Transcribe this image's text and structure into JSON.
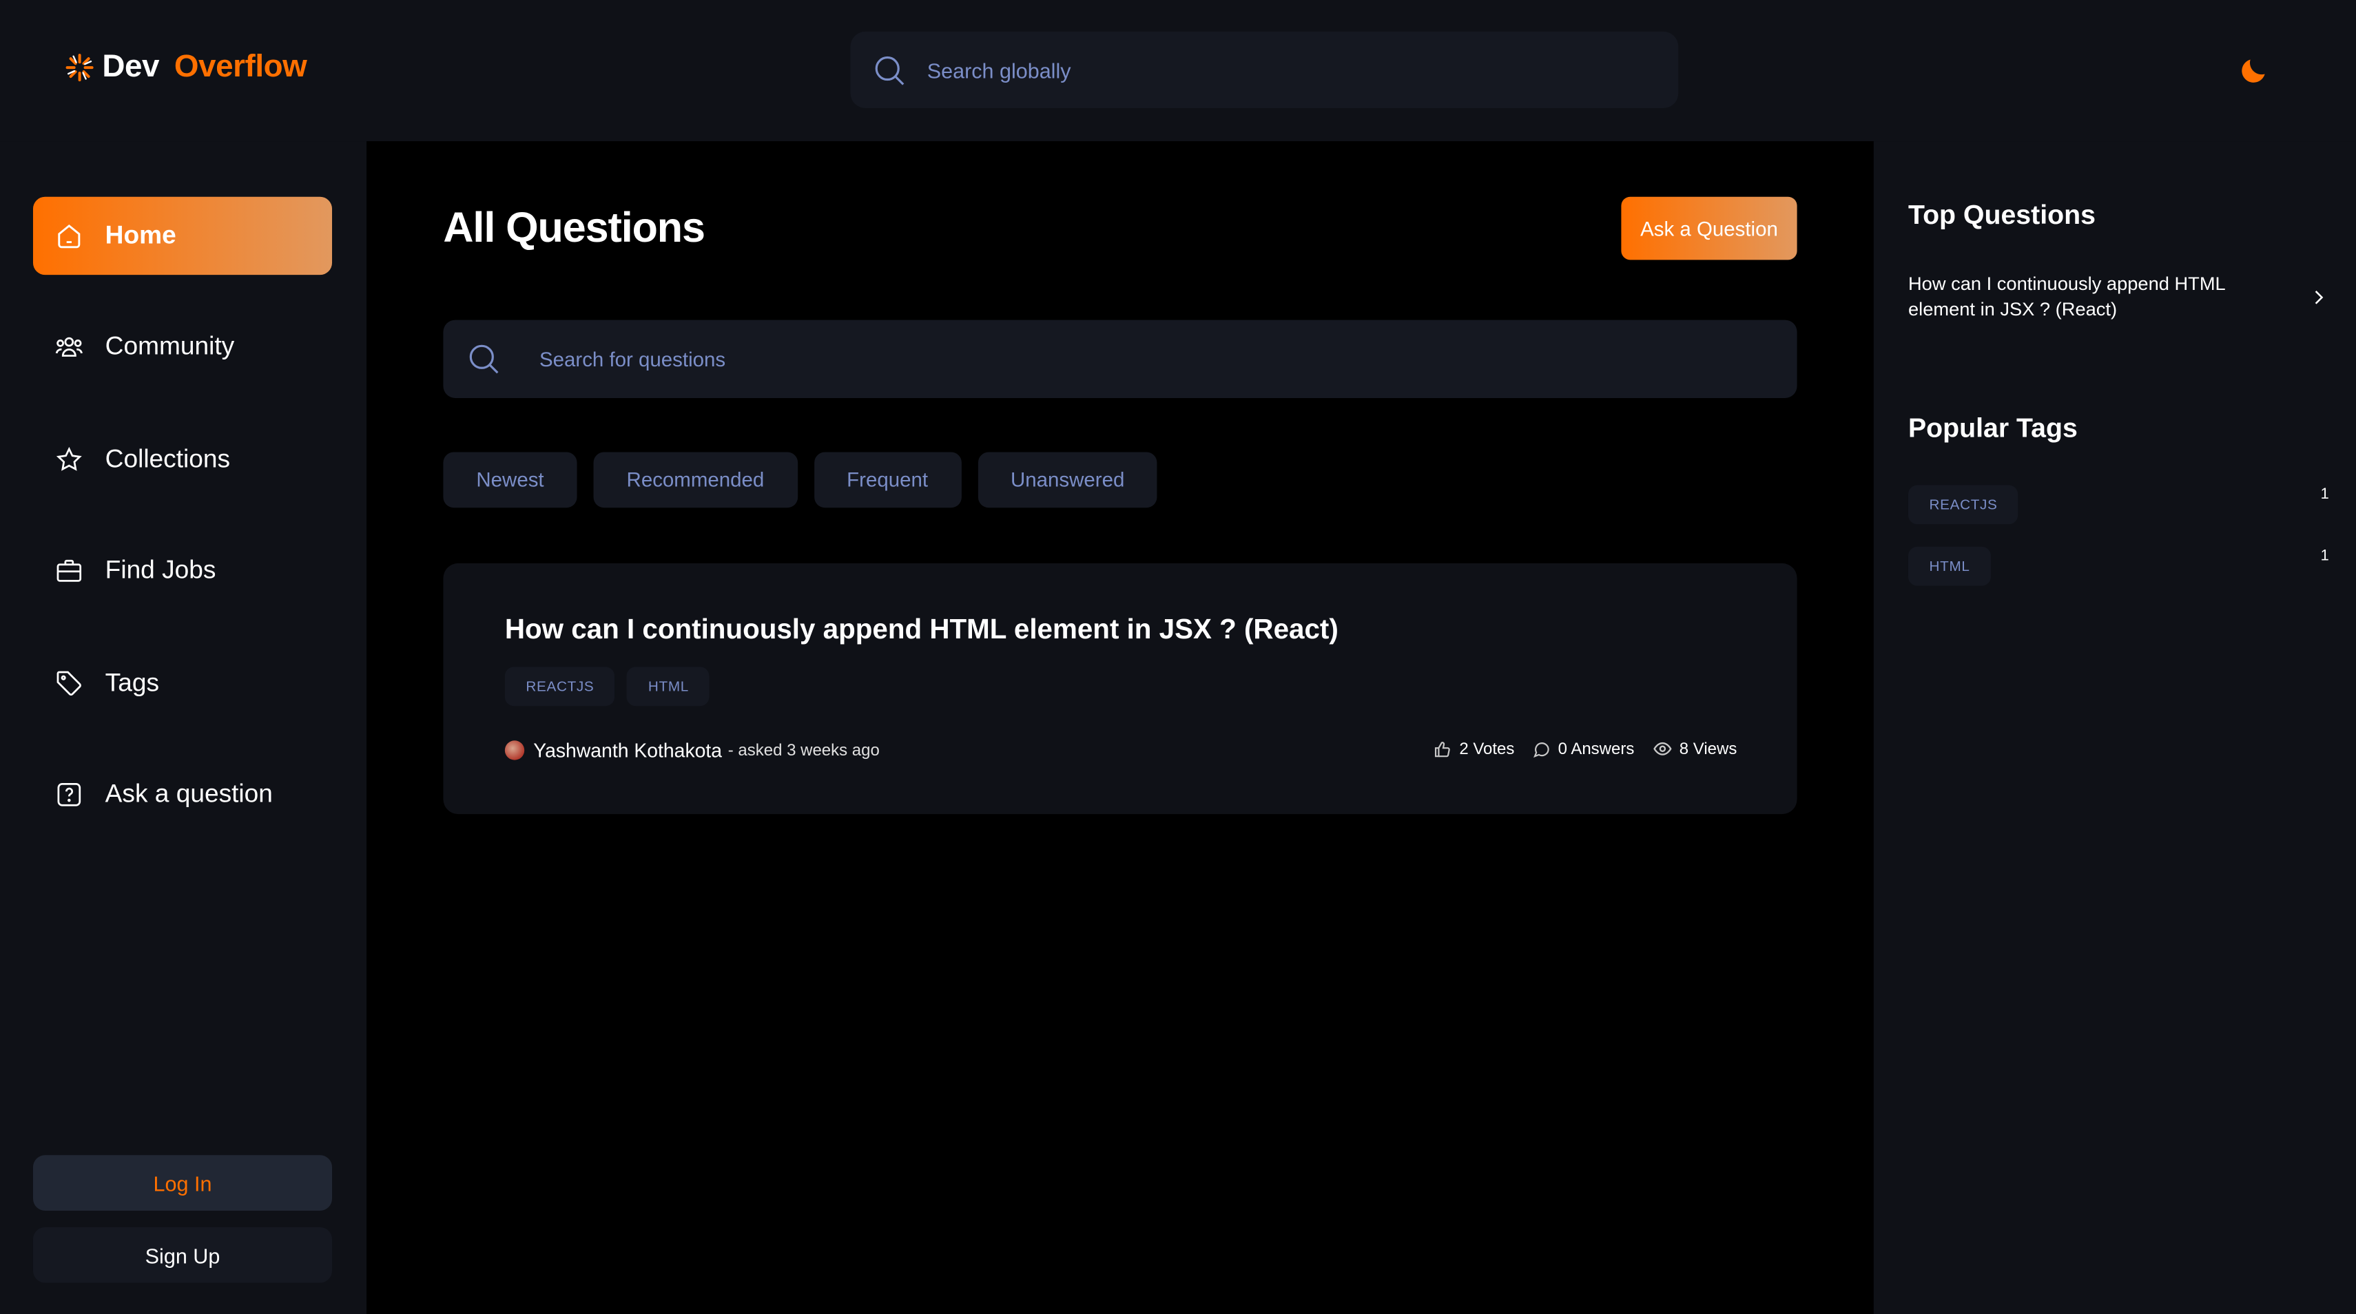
{
  "brand": {
    "dev": "Dev",
    "overflow": "Overflow"
  },
  "colors": {
    "accent": "#ff7000",
    "accent_end": "#e2985e",
    "bg": "#000000",
    "panel": "#0f1117",
    "chip": "#151821",
    "muted": "#7b8ec8"
  },
  "header": {
    "search_placeholder": "Search globally"
  },
  "sidebar": {
    "items": [
      {
        "label": "Home",
        "icon": "home-icon",
        "active": true
      },
      {
        "label": "Community",
        "icon": "users-icon"
      },
      {
        "label": "Collections",
        "icon": "star-icon"
      },
      {
        "label": "Find Jobs",
        "icon": "briefcase-icon"
      },
      {
        "label": "Tags",
        "icon": "tag-icon"
      },
      {
        "label": "Ask a question",
        "icon": "question-icon"
      }
    ],
    "login": "Log In",
    "signup": "Sign Up"
  },
  "main": {
    "title": "All Questions",
    "ask_button": "Ask a Question",
    "search_placeholder": "Search for questions",
    "filters": [
      "Newest",
      "Recommended",
      "Frequent",
      "Unanswered"
    ],
    "questions": [
      {
        "title": "How can I continuously append HTML element in JSX ? (React)",
        "tags": [
          "REACTJS",
          "HTML"
        ],
        "author": "Yashwanth Kothakota",
        "asked": " - asked 3 weeks ago",
        "votes": "2 Votes",
        "answers": "0 Answers",
        "views": "8 Views"
      }
    ]
  },
  "right": {
    "top_title": "Top Questions",
    "top_questions": [
      "How can I continuously append HTML element in JSX ? (React)"
    ],
    "tags_title": "Popular Tags",
    "tags": [
      {
        "name": "REACTJS",
        "count": "1"
      },
      {
        "name": "HTML",
        "count": "1"
      }
    ]
  }
}
